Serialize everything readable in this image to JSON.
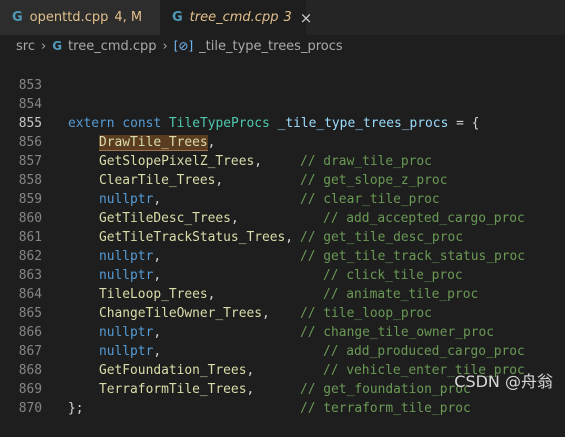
{
  "tabs": [
    {
      "filename": "openttd.cpp",
      "badge": "4, M",
      "icon": "c-plus-plus-file-icon"
    },
    {
      "filename": "tree_cmd.cpp",
      "badge": "3",
      "close": "×",
      "icon": "c-plus-plus-file-icon"
    }
  ],
  "breadcrumb": {
    "folder": "src",
    "file": "tree_cmd.cpp",
    "symbol": "_tile_type_trees_procs",
    "sep": "›"
  },
  "editor": {
    "lines": [
      {
        "num": "853",
        "code": ""
      },
      {
        "num": "854",
        "decl_kw1": "extern",
        "decl_kw2": "const",
        "decl_type": "TileTypeProcs",
        "decl_name": "_tile_type_trees_procs",
        "decl_rest": " = {"
      },
      {
        "num": "855",
        "name": "DrawTile_Trees",
        "comma": ",",
        "comment": "// draw_tile_proc"
      },
      {
        "num": "856",
        "name": "GetSlopePixelZ_Trees",
        "comma": ",",
        "comment": "// get_slope_z_proc"
      },
      {
        "num": "857",
        "name": "ClearTile_Trees",
        "comma": ",",
        "comment": "// clear_tile_proc"
      },
      {
        "num": "858",
        "name": "nullptr",
        "comma": ",",
        "comment": "// add_accepted_cargo_proc"
      },
      {
        "num": "859",
        "name": "GetTileDesc_Trees",
        "comma": ",",
        "comment": "// get_tile_desc_proc"
      },
      {
        "num": "860",
        "name": "GetTileTrackStatus_Trees",
        "comma": ",",
        "comment": "// get_tile_track_status_proc"
      },
      {
        "num": "861",
        "name": "nullptr",
        "comma": ",",
        "comment": "// click_tile_proc"
      },
      {
        "num": "862",
        "name": "nullptr",
        "comma": ",",
        "comment": "// animate_tile_proc"
      },
      {
        "num": "863",
        "name": "TileLoop_Trees",
        "comma": ",",
        "comment": "// tile_loop_proc"
      },
      {
        "num": "864",
        "name": "ChangeTileOwner_Trees",
        "comma": ",",
        "comment": "// change_tile_owner_proc"
      },
      {
        "num": "865",
        "name": "nullptr",
        "comma": ",",
        "comment": "// add_produced_cargo_proc"
      },
      {
        "num": "866",
        "name": "nullptr",
        "comma": ",",
        "comment": "// vehicle_enter_tile_proc"
      },
      {
        "num": "867",
        "name": "GetFoundation_Trees",
        "comma": ",",
        "comment": "// get_foundation_proc"
      },
      {
        "num": "868",
        "name": "TerraformTile_Trees",
        "comma": ",",
        "comment": "// terraform_tile_proc"
      },
      {
        "num": "869",
        "code": "};"
      },
      {
        "num": "870",
        "code": ""
      }
    ]
  },
  "watermark": "CSDN @舟翁",
  "colors": {
    "keyword": "#569cd6",
    "type": "#4ec9b0",
    "function": "#dcdcaa",
    "variable": "#9cdcfe",
    "comment": "#6a9955",
    "modified": "#e2c08d"
  }
}
